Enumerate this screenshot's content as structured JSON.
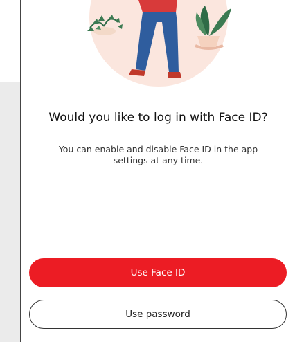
{
  "dialog": {
    "title": "Would you like to log in with Face ID?",
    "subtitle": "You can enable and disable Face ID in the app settings at any time."
  },
  "buttons": {
    "primary_label": "Use Face ID",
    "secondary_label": "Use password"
  },
  "colors": {
    "accent": "#ec1c24",
    "illustration_circle": "#fbe6de",
    "backdrop": "#ebebeb"
  },
  "icons": {
    "illustration": "person-with-plants-illustration"
  }
}
